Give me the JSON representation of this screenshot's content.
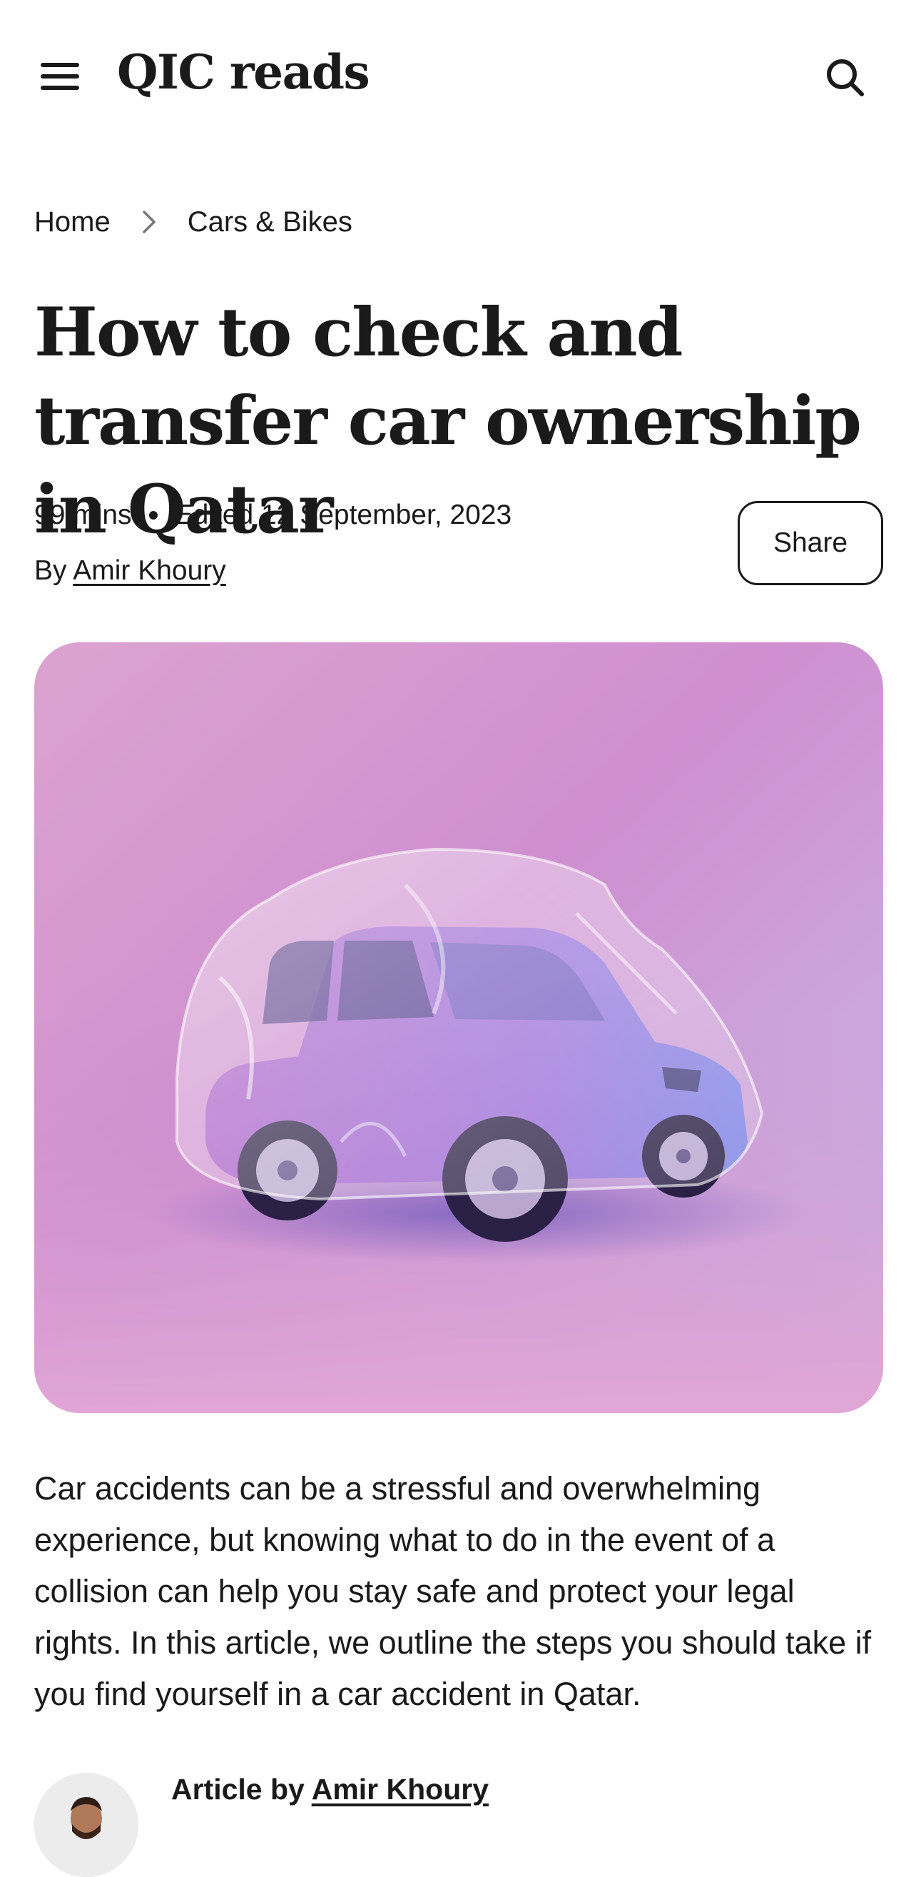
{
  "header": {
    "logo": "QIC reads",
    "menu_icon": "hamburger-menu-icon",
    "search_icon": "search-icon"
  },
  "breadcrumb": {
    "items": [
      "Home",
      "Cars & Bikes"
    ],
    "separator_icon": "chevron-right-icon"
  },
  "article": {
    "title": "How to check and transfer car ownership in Qatar",
    "read_time": "99 mins",
    "edited": "Edited 12 September, 2023",
    "by_prefix": "By",
    "author": "Amir Khoury",
    "share_label": "Share",
    "hero_image": "purple car wrapped in transparent plastic on pink background",
    "intro": "Car accidents can be a stressful and overwhelming experience, but knowing what to do in the event of a collision can help you stay safe and protect your legal rights. In this article, we outline the steps you should take if you find yourself in a car accident in Qatar.",
    "article_by_prefix": "Article by",
    "article_by_author": "Amir Khoury"
  },
  "colors": {
    "text": "#1a1a1a",
    "background": "#ffffff",
    "hero_pink": "#d99bd0",
    "hero_lavender": "#c6bfe8"
  }
}
